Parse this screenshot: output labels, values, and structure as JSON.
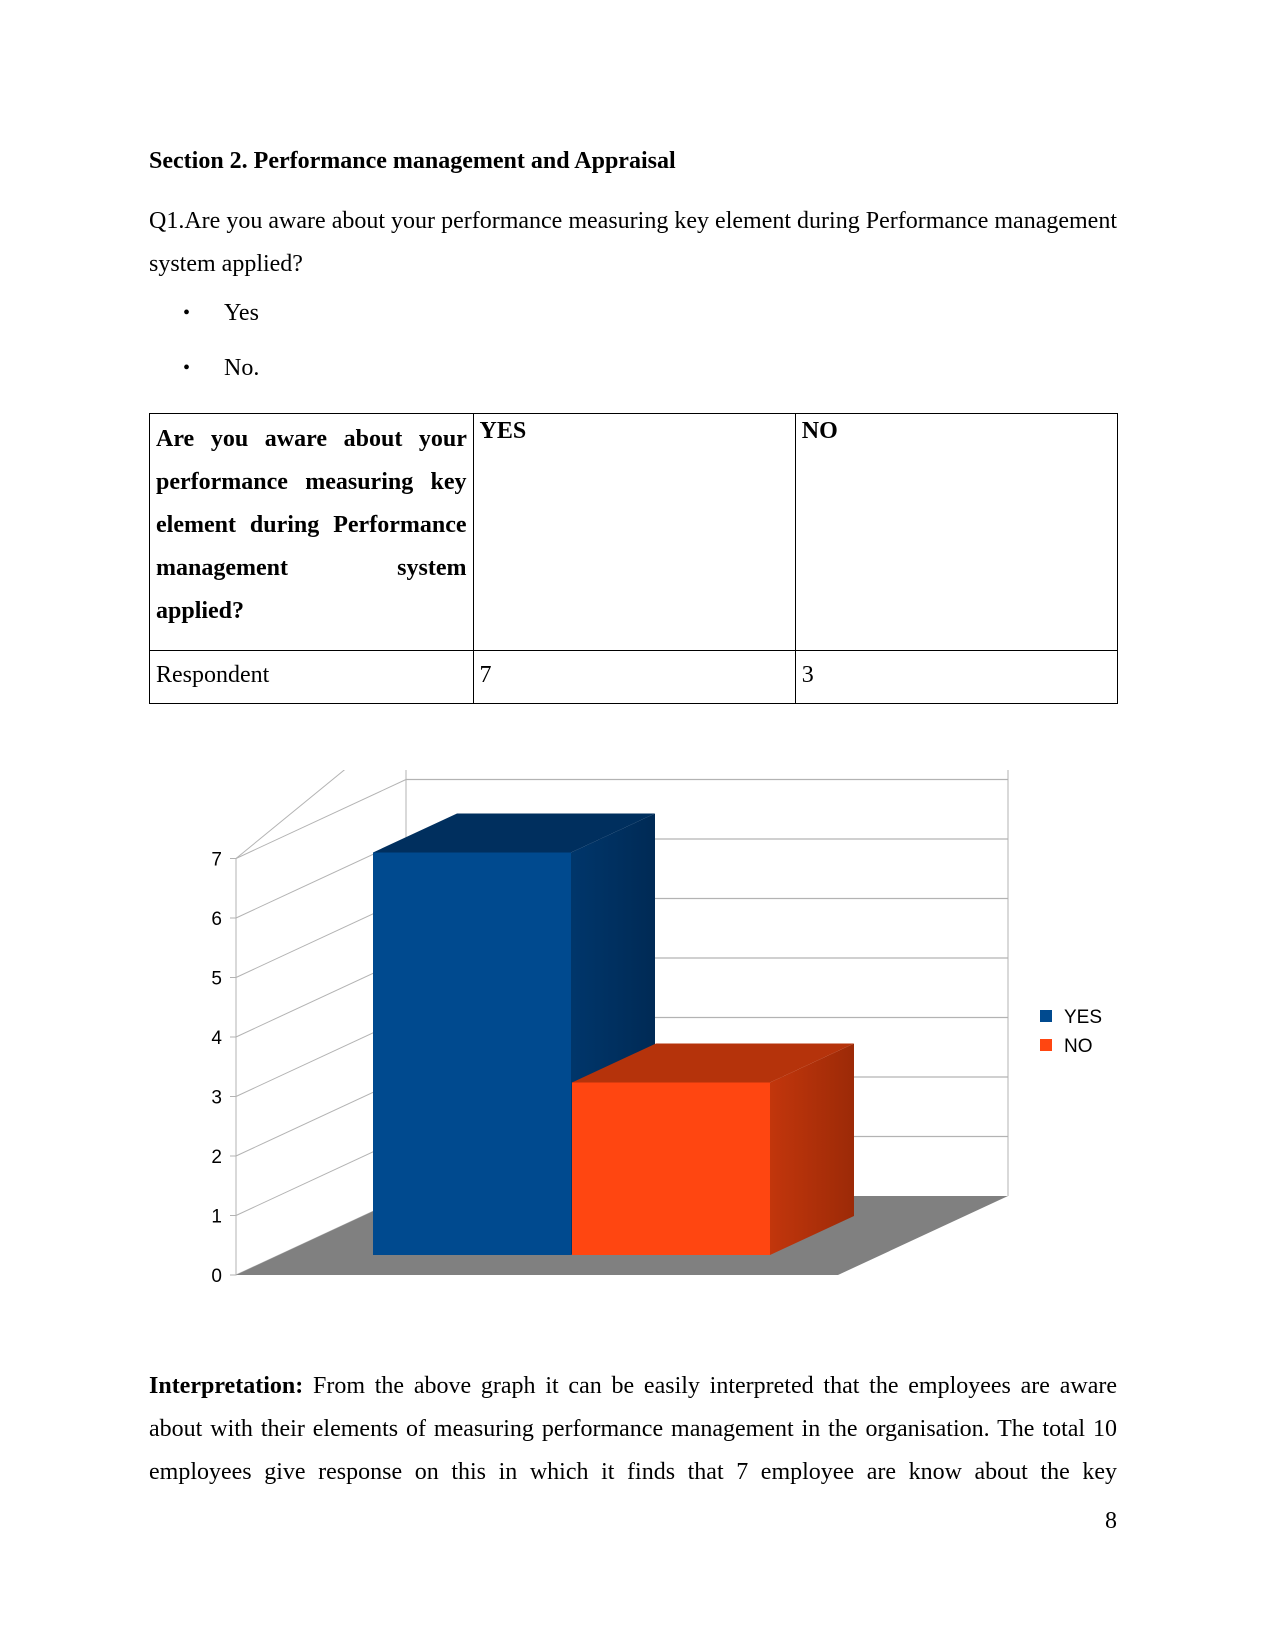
{
  "section_title": "Section 2. Performance management and Appraisal",
  "question": "Q1.Are you aware about your performance measuring key element during Performance management system applied?",
  "options": [
    {
      "bullet": "•",
      "label": "Yes"
    },
    {
      "bullet": "•",
      "label": "No."
    }
  ],
  "table": {
    "question_cell": [
      "Are you aware about your",
      "performance measuring key",
      "element during Performance",
      "management system",
      "applied?"
    ],
    "headers": [
      "YES",
      "NO"
    ],
    "row_label": "Respondent",
    "values": [
      "7",
      "3"
    ]
  },
  "chart_data": {
    "type": "bar",
    "style": "3d-column",
    "title": "",
    "xlabel": "",
    "ylabel": "",
    "categories": [
      ""
    ],
    "series": [
      {
        "name": "YES",
        "values": [
          7
        ],
        "color": "#004A8F"
      },
      {
        "name": "NO",
        "values": [
          3
        ],
        "color": "#FF4611"
      }
    ],
    "ylim": [
      0,
      7
    ],
    "yticks": [
      "0",
      "1",
      "2",
      "3",
      "4",
      "5",
      "6",
      "7"
    ],
    "grid": true,
    "legend": "right"
  },
  "interpretation": {
    "label": "Interpretation:",
    "text": " From the above graph it can be easily interpreted that the employees are aware about with their elements of measuring performance management in the organisation. The total 10 employees give response on this in which it finds that 7 employee are know about the key"
  },
  "page_number": "8"
}
